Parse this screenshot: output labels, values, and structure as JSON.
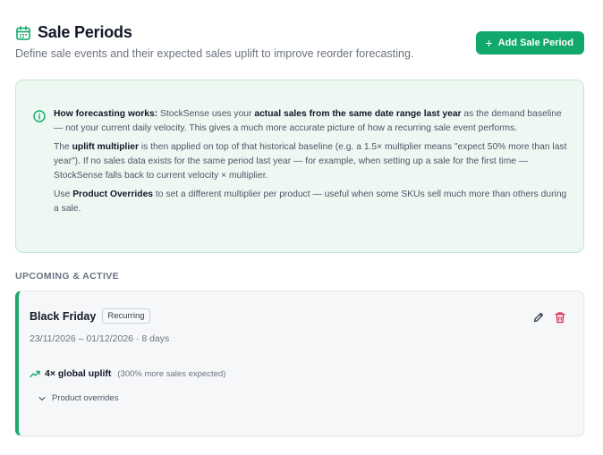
{
  "header": {
    "title": "Sale Periods",
    "subtitle": "Define sale events and their expected sales uplift to improve reorder forecasting.",
    "add_button_label": "Add Sale Period",
    "calendar_icon": "calendar-icon"
  },
  "info": {
    "icon": "info-icon",
    "p1_lead": "How forecasting works:",
    "p1_a": " StockSense uses your ",
    "p1_bold": "actual sales from the same date range last year",
    "p1_b": " as the demand baseline — not your current daily velocity. This gives a much more accurate picture of how a recurring sale event performs.",
    "p2_a": "The ",
    "p2_bold": "uplift multiplier",
    "p2_b": " is then applied on top of that historical baseline (e.g. a 1.5× multiplier means \"expect 50% more than last year\"). If no sales data exists for the same period last year — for example, when setting up a sale for the first time — StockSense falls back to current velocity × multiplier.",
    "p3_a": "Use ",
    "p3_bold": "Product Overrides",
    "p3_b": " to set a different multiplier per product — useful when some SKUs sell much more than others during a sale."
  },
  "section": {
    "heading": "UPCOMING & ACTIVE"
  },
  "sale": {
    "name": "Black Friday",
    "badge": "Recurring",
    "dates": "23/11/2026 – 01/12/2026 · 8 days",
    "uplift_label": "4× global uplift",
    "uplift_note": "(300% more sales expected)",
    "overrides_label": "Product overrides",
    "accent_color": "#1aa86b",
    "icons": {
      "edit": "pencil-icon",
      "delete": "trash-icon",
      "trend": "trending-up-icon",
      "expand": "chevron-down-icon"
    }
  },
  "colors": {
    "primary": "#10a86b",
    "danger": "#e11d48",
    "info_bg": "#eef8f3"
  }
}
